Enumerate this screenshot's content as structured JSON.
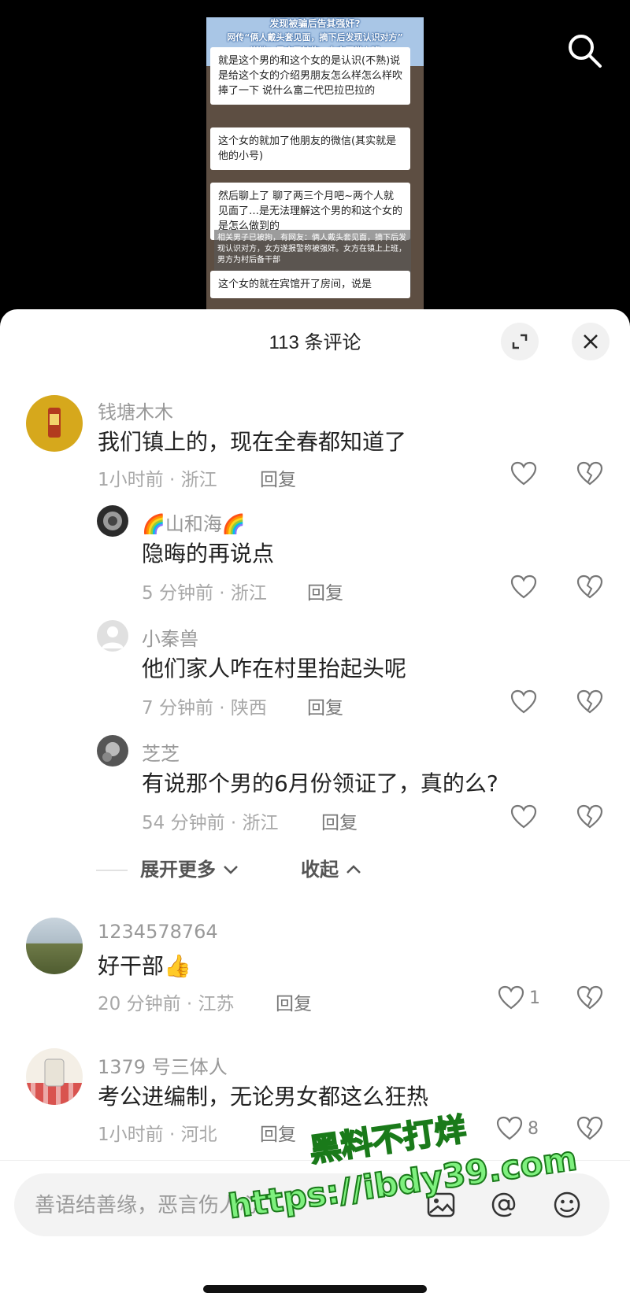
{
  "video": {
    "banner_lines": [
      "发现被骗后告其强奸?",
      "网传“俩人戴头套见面，摘下后发现认识对方”",
      "当地：男方已被拘，女方正常上班"
    ],
    "chat_bubbles": [
      "就是这个男的和这个女的是认识(不熟)说是给这个女的介绍男朋友怎么样怎么样吹捧了一下 说什么富二代巴拉巴拉的",
      "这个女的就加了他朋友的微信(其实就是他的小号)",
      "然后聊上了 聊了两三个月吧~两个人就见面了…是无法理解这个男的和这个女的是怎么做到的",
      "这个女的就在宾馆开了房间，说是"
    ],
    "overlay_text": "相关男子已被拘，有网友：俩人戴头套见面，摘下后发现认识对方，女方遂报警称被强奸。女方在镇上上班，男方为村后备干部"
  },
  "sheet": {
    "title": "113 条评论"
  },
  "comments": [
    {
      "user": "钱塘木木",
      "text": "我们镇上的，现在全春都知道了",
      "meta": "1小时前 · 浙江",
      "reply": "回复",
      "likes": ""
    },
    {
      "user": "🌈山和海🌈",
      "text": "隐晦的再说点",
      "meta": "5 分钟前 · 浙江",
      "reply": "回复",
      "likes": ""
    },
    {
      "user": "小秦兽",
      "text": "他们家人咋在村里抬起头呢",
      "meta": "7 分钟前 · 陕西",
      "reply": "回复",
      "likes": ""
    },
    {
      "user": "芝芝",
      "text": "有说那个男的6月份领证了，真的么?",
      "meta": "54 分钟前 · 浙江",
      "reply": "回复",
      "likes": ""
    },
    {
      "user": "1234578764",
      "text": "好干部👍",
      "meta": "20 分钟前 · 江苏",
      "reply": "回复",
      "likes": "1"
    },
    {
      "user": "1379 号三体人",
      "text": "考公进编制，无论男女都这么狂热",
      "meta": "1小时前 · 河北",
      "reply": "回复",
      "likes": "8"
    }
  ],
  "expand": {
    "more": "展开更多",
    "collapse": "收起"
  },
  "input": {
    "placeholder": "善语结善缘，恶言伤人心"
  },
  "watermark": {
    "line1": "黑料不打烊",
    "line2": "https://ibdy39.com"
  },
  "colors": {
    "watermark": "#7ef07e",
    "banner": "#a9c6e6"
  },
  "icons": [
    "search-icon",
    "expand-icon",
    "close-icon",
    "heart-icon",
    "broken-heart-icon",
    "image-icon",
    "at-icon",
    "emoji-icon",
    "chevron-down-icon",
    "chevron-up-icon"
  ]
}
